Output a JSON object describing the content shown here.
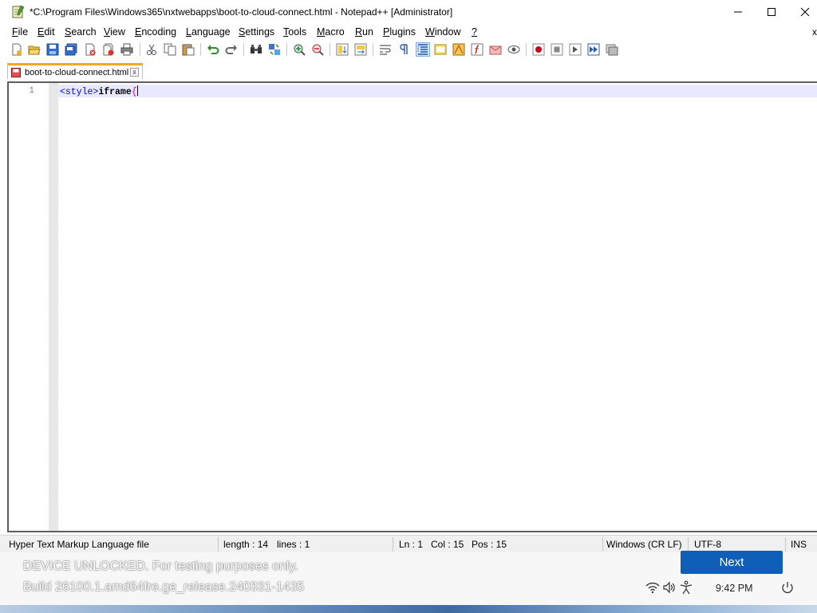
{
  "window": {
    "title": "*C:\\Program Files\\Windows365\\nxtwebapps\\boot-to-cloud-connect.html - Notepad++ [Administrator]",
    "controls": [
      "minimize-icon",
      "maximize-icon",
      "close-icon"
    ]
  },
  "menu": {
    "items": [
      {
        "label": "File",
        "underline": "F",
        "rest": "ile"
      },
      {
        "label": "Edit",
        "underline": "E",
        "rest": "dit"
      },
      {
        "label": "Search",
        "underline": "S",
        "rest": "earch"
      },
      {
        "label": "View",
        "underline": "V",
        "rest": "iew"
      },
      {
        "label": "Encoding",
        "underline": "E",
        "rest": "ncoding"
      },
      {
        "label": "Language",
        "underline": "L",
        "rest": "anguage"
      },
      {
        "label": "Settings",
        "underline": "S",
        "rest": "ettings"
      },
      {
        "label": "Tools",
        "underline": "T",
        "rest": "ools"
      },
      {
        "label": "Macro",
        "underline": "M",
        "rest": "acro"
      },
      {
        "label": "Run",
        "underline": "R",
        "rest": "un"
      },
      {
        "label": "Plugins",
        "underline": "P",
        "rest": "lugins"
      },
      {
        "label": "Window",
        "underline": "W",
        "rest": "indow"
      },
      {
        "label": "?",
        "underline": "?",
        "rest": ""
      }
    ],
    "close_doc": "x"
  },
  "toolbar": {
    "buttons": [
      "new-file-icon",
      "open-file-icon",
      "save-icon",
      "save-all-icon",
      "close-icon",
      "close-all-icon",
      "print-icon",
      "cut-icon",
      "copy-icon",
      "paste-icon",
      "undo-icon",
      "redo-icon",
      "find-icon",
      "replace-icon",
      "zoom-in-icon",
      "zoom-out-icon",
      "sync-vertical-icon",
      "sync-horizontal-icon",
      "word-wrap-icon",
      "show-all-chars-icon",
      "indent-guide-icon",
      "language-folder-icon",
      "document-map-icon",
      "function-list-icon",
      "folder-workspace-icon",
      "monitor-icon",
      "record-macro-icon",
      "stop-record-icon",
      "play-macro-icon",
      "run-multiple-icon",
      "save-macro-icon"
    ]
  },
  "tab": {
    "label": "boot-to-cloud-connect.html",
    "close": "x"
  },
  "editor": {
    "line_number": "1",
    "code": {
      "tag": "<style>",
      "text": "iframe",
      "brace": "{"
    }
  },
  "status": {
    "language": "Hyper Text Markup Language file",
    "length": "length : 14",
    "lines": "lines : 1",
    "ln": "Ln : 1",
    "col": "Col : 15",
    "pos": "Pos : 15",
    "eol": "Windows (CR LF)",
    "encoding": "UTF-8",
    "mode": "INS"
  },
  "oobe": {
    "watermark_line1": "DEVICE UNLOCKED. For testing purposes only.",
    "watermark_line2": "Build 26100.1.amd64fre.ge_release.240331-1435",
    "next_label": "Next",
    "clock": "9:42 PM",
    "tray_icons": [
      "wifi-icon",
      "volume-icon",
      "accessibility-icon",
      "power-icon"
    ]
  }
}
